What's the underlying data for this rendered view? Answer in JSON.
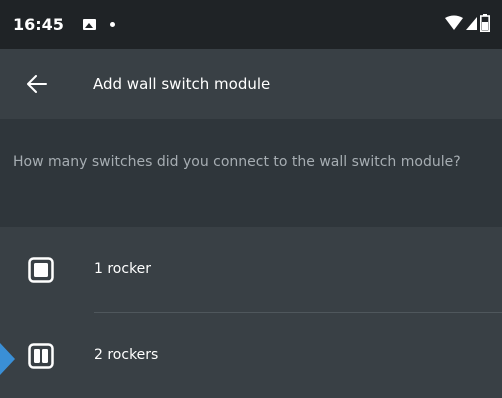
{
  "status_bar": {
    "time": "16:45"
  },
  "app_bar": {
    "title": "Add wall switch module"
  },
  "question": {
    "text": "How many switches did you connect to the wall switch module?"
  },
  "options": [
    {
      "label": "1 rocker"
    },
    {
      "label": "2 rockers"
    }
  ],
  "colors": {
    "status_bar_bg": "#1f2326",
    "app_bar_bg": "#394045",
    "question_bg": "#2f363b",
    "list_bg": "#394045",
    "question_text": "#a6adb2",
    "pointer_hint": "#3a8fd6"
  },
  "icons": {
    "back": "arrow-left-icon",
    "option_1": "single-rocker-icon",
    "option_2": "double-rocker-icon",
    "wifi": "wifi-icon",
    "signal": "cell-signal-icon",
    "battery": "battery-icon",
    "image": "image-notification-icon"
  }
}
